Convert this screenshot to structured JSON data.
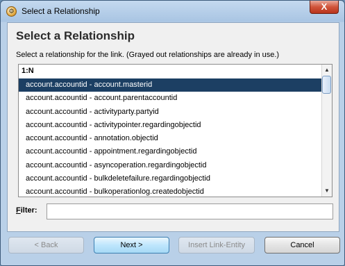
{
  "window": {
    "title": "Select a Relationship",
    "close_glyph": "X"
  },
  "main": {
    "heading": "Select a Relationship",
    "instructions": "Select a relationship for the link. (Grayed out relationships are already in use.)"
  },
  "list": {
    "group_header": "1:N",
    "items": [
      {
        "label": "account.accountid - account.masterid",
        "selected": true
      },
      {
        "label": "account.accountid - account.parentaccountid",
        "selected": false
      },
      {
        "label": "account.accountid - activityparty.partyid",
        "selected": false
      },
      {
        "label": "account.accountid - activitypointer.regardingobjectid",
        "selected": false
      },
      {
        "label": "account.accountid - annotation.objectid",
        "selected": false
      },
      {
        "label": "account.accountid - appointment.regardingobjectid",
        "selected": false
      },
      {
        "label": "account.accountid - asyncoperation.regardingobjectid",
        "selected": false
      },
      {
        "label": "account.accountid - bulkdeletefailure.regardingobjectid",
        "selected": false
      },
      {
        "label": "account.accountid - bulkoperationlog.createdobjectid",
        "selected": false
      }
    ]
  },
  "filter": {
    "label_underlined": "F",
    "label_rest": "ilter:",
    "value": ""
  },
  "buttons": {
    "back": "< Back",
    "next": "Next >",
    "insert_link_entity": "Insert Link-Entity",
    "cancel": "Cancel"
  },
  "icons": {
    "app": "app-icon",
    "close": "close-icon",
    "scroll_up": "scroll-up-arrow-icon",
    "scroll_down": "scroll-down-arrow-icon"
  },
  "colors": {
    "selection": "#1c3f63",
    "close_button": "#c8432a",
    "primary_button": "#bee6fd"
  }
}
